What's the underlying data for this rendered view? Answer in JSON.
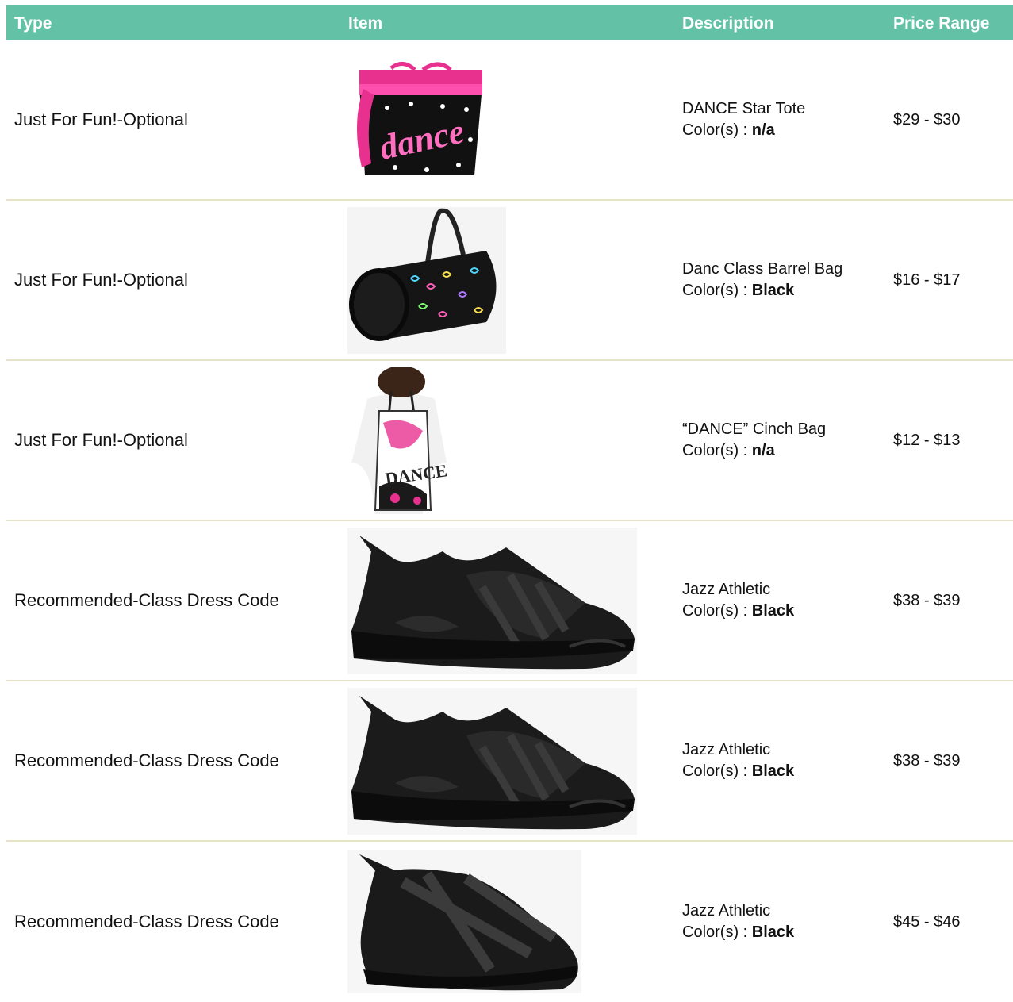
{
  "header": {
    "type": "Type",
    "item": "Item",
    "description": "Description",
    "price": "Price Range"
  },
  "colors": {
    "header_bg": "#63c2a6",
    "row_divider": "#e6e3c6",
    "accent_pink": "#e8318e"
  },
  "color_label": "Color(s) : ",
  "rows": [
    {
      "type": "Just For Fun!-Optional",
      "image_icon": "star-tote-bag-icon",
      "name": "DANCE Star Tote",
      "color": "n/a",
      "price": "$29 - $30"
    },
    {
      "type": "Just For Fun!-Optional",
      "image_icon": "barrel-bag-icon",
      "name": "Danc Class Barrel Bag",
      "color": "Black",
      "price": "$16 - $17"
    },
    {
      "type": "Just For Fun!-Optional",
      "image_icon": "cinch-bag-icon",
      "name": "“DANCE” Cinch Bag",
      "color": "n/a",
      "price": "$12 - $13"
    },
    {
      "type": "Recommended-Class Dress Code",
      "image_icon": "jazz-sneaker-icon",
      "name": "Jazz Athletic",
      "color": "Black",
      "price": "$38 - $39"
    },
    {
      "type": "Recommended-Class Dress Code",
      "image_icon": "jazz-sneaker-icon",
      "name": "Jazz Athletic",
      "color": "Black",
      "price": "$38 - $39"
    },
    {
      "type": "Recommended-Class Dress Code",
      "image_icon": "strap-sneaker-icon",
      "name": "Jazz Athletic",
      "color": "Black",
      "price": "$45 - $46"
    }
  ]
}
